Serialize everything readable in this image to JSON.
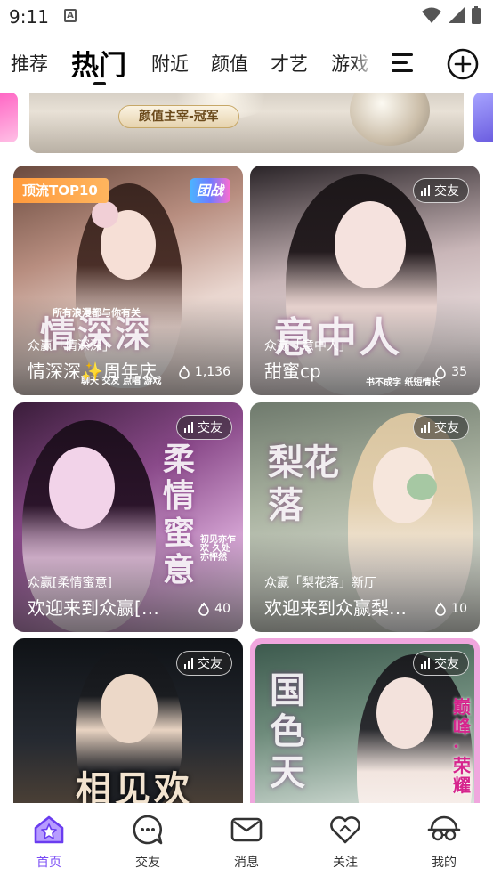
{
  "status_bar": {
    "time": "9:11",
    "notification_icon": "A"
  },
  "tabs": [
    {
      "label": "推荐"
    },
    {
      "label": "热门",
      "active": true
    },
    {
      "label": "附近"
    },
    {
      "label": "颜值"
    },
    {
      "label": "才艺"
    },
    {
      "label": "游戏"
    }
  ],
  "banner": {
    "label": "颜值主宰-冠军"
  },
  "cards": [
    {
      "badge": "顶流TOP10",
      "team_badge": "团战",
      "room": "众赢「情深深」",
      "title": "情深深✨周年庆",
      "heat": "1,136",
      "deco": "情深深",
      "deco_sub": "所有浪漫都与你有关",
      "footer": "聊天 交友 点唱 游戏"
    },
    {
      "tag": "交友",
      "room": "众赢「意中人」",
      "title": "甜蜜cp",
      "heat": "35",
      "deco": "意中人",
      "deco_sub": "书不成字 纸短情长"
    },
    {
      "tag": "交友",
      "room": "众赢[柔情蜜意]",
      "title": "欢迎来到众赢[柔情蜜意]",
      "heat": "40",
      "deco": "柔情蜜意",
      "deco_sub": "初见亦乍欢 久处亦怦然"
    },
    {
      "tag": "交友",
      "room": "众赢「梨花落」新厅",
      "title": "欢迎来到众赢梨花落",
      "heat": "10",
      "deco": "梨花落"
    },
    {
      "tag": "交友",
      "deco": "相见欢"
    },
    {
      "tag": "交友",
      "deco": "国色天",
      "deco_side": "巅峰·荣耀"
    }
  ],
  "bottom_nav": [
    {
      "label": "首页",
      "icon": "home-star-icon",
      "active": true
    },
    {
      "label": "交友",
      "icon": "chat-bubble-icon"
    },
    {
      "label": "消息",
      "icon": "mail-icon"
    },
    {
      "label": "关注",
      "icon": "heart-icon"
    },
    {
      "label": "我的",
      "icon": "profile-glasses-icon"
    }
  ],
  "colors": {
    "accent": "#7a4cf5",
    "badge_top": "#ff9a3c"
  }
}
